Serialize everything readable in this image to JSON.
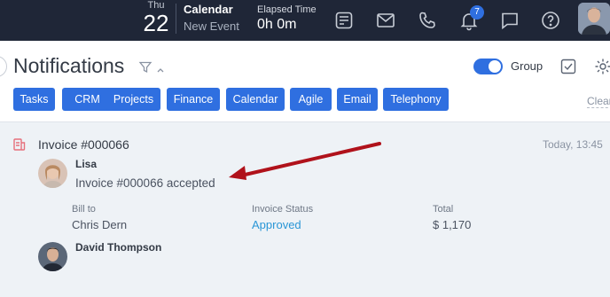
{
  "topbar": {
    "day_name": "Thu",
    "day_number": "22",
    "calendar_title": "Calendar",
    "calendar_sub": "New Event",
    "elapsed_label": "Elapsed Time",
    "elapsed_value": "0h 0m",
    "bell_count": "7",
    "icons": [
      "feed-icon",
      "mail-icon",
      "phone-icon",
      "bell-icon",
      "chat-icon",
      "help-icon"
    ]
  },
  "header": {
    "title": "Notifications",
    "group_label": "Group",
    "group_enabled": true,
    "clear_label": "Clear"
  },
  "tabs": [
    {
      "label": "Tasks"
    },
    {
      "label": "CRM"
    },
    {
      "label": "Projects"
    },
    {
      "label": "Finance"
    },
    {
      "label": "Calendar"
    },
    {
      "label": "Agile"
    },
    {
      "label": "Email"
    },
    {
      "label": "Telephony"
    }
  ],
  "notification": {
    "title": "Invoice #000066",
    "timestamp": "Today, 13:45",
    "author": "Lisa",
    "message": "Invoice #000066 accepted",
    "fields": [
      {
        "label": "Bill to",
        "value": "Chris Dern"
      },
      {
        "label": "Invoice Status",
        "value": "Approved"
      },
      {
        "label": "Total",
        "value": "$ 1,170"
      }
    ],
    "second_author": "David Thompson"
  },
  "colors": {
    "topbar_bg": "#1f2637",
    "accent": "#2f6fe0",
    "content_bg": "#eef2f6",
    "arrow": "#b0121b",
    "status_link": "#2a96d6"
  }
}
